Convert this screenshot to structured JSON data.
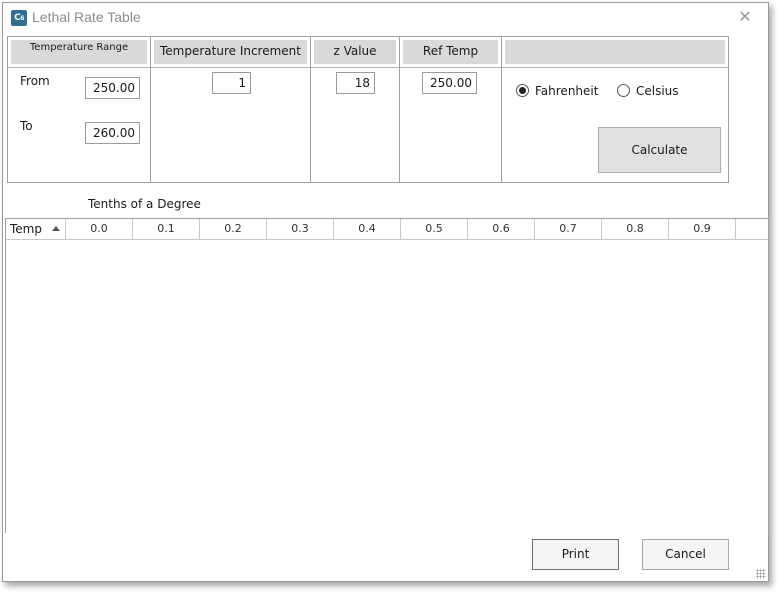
{
  "window": {
    "title": "Lethal Rate Table",
    "icon": "app-c-icon"
  },
  "params": {
    "temp_range": {
      "header": "Temperature Range",
      "from_label": "From",
      "from_value": "250.00",
      "to_label": "To",
      "to_value": "260.00"
    },
    "increment": {
      "header": "Temperature Increment",
      "value": "1"
    },
    "z_value": {
      "header": "z Value",
      "value": "18"
    },
    "ref_temp": {
      "header": "Ref Temp",
      "value": "250.00"
    },
    "units": {
      "options": [
        "Fahrenheit",
        "Celsius"
      ],
      "selected": "Fahrenheit"
    },
    "calculate_label": "Calculate"
  },
  "grid": {
    "caption": "Tenths of a Degree",
    "temp_col": "Temp",
    "columns": [
      "0.0",
      "0.1",
      "0.2",
      "0.3",
      "0.4",
      "0.5",
      "0.6",
      "0.7",
      "0.8",
      "0.9"
    ],
    "rows": []
  },
  "buttons": {
    "print": "Print",
    "cancel": "Cancel"
  },
  "colors": {
    "header_bg": "#d9d9d9",
    "button_bg": "#e1e1e1",
    "title_text": "#8c8c8c",
    "icon_bg": "#2f6f93"
  }
}
